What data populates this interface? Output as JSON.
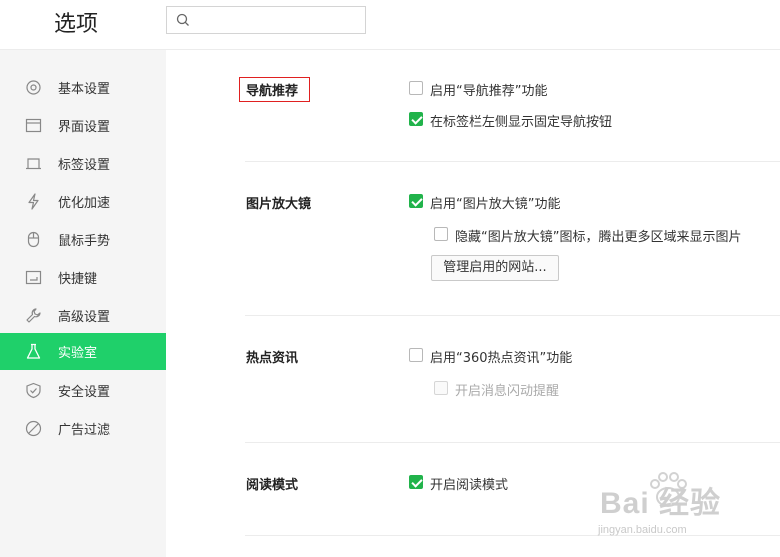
{
  "header": {
    "title": "选项",
    "search": {
      "placeholder": "",
      "value": ""
    }
  },
  "sidebar": {
    "items": [
      {
        "label": "基本设置",
        "icon": "gear-icon"
      },
      {
        "label": "界面设置",
        "icon": "window-icon"
      },
      {
        "label": "标签设置",
        "icon": "tab-icon"
      },
      {
        "label": "优化加速",
        "icon": "lightning-icon"
      },
      {
        "label": "鼠标手势",
        "icon": "mouse-icon"
      },
      {
        "label": "快捷键",
        "icon": "keyboard-icon"
      },
      {
        "label": "高级设置",
        "icon": "wrench-icon"
      },
      {
        "label": "实验室",
        "icon": "flask-icon",
        "active": true
      },
      {
        "label": "安全设置",
        "icon": "shield-icon"
      },
      {
        "label": "广告过滤",
        "icon": "block-icon"
      }
    ],
    "active_color": "#1fd06a"
  },
  "sections": {
    "nav": {
      "title": "导航推荐",
      "opt1": "启用“导航推荐”功能",
      "opt2": "在标签栏左侧显示固定导航按钮"
    },
    "magnifier": {
      "title": "图片放大镜",
      "opt1": "启用“图片放大镜”功能",
      "opt2": "隐藏“图片放大镜”图标，腾出更多区域来显示图片",
      "button": "管理启用的网站..."
    },
    "hotnews": {
      "title": "热点资讯",
      "opt1": "启用“360热点资讯”功能",
      "opt2": "开启消息闪动提醒"
    },
    "reading": {
      "title": "阅读模式",
      "opt1": "开启阅读模式"
    }
  },
  "watermark": {
    "brand": "Bai 经验",
    "url": "jingyan.baidu.com"
  },
  "colors": {
    "checkbox_on": "#21b34b",
    "highlight_box": "#e02020"
  }
}
